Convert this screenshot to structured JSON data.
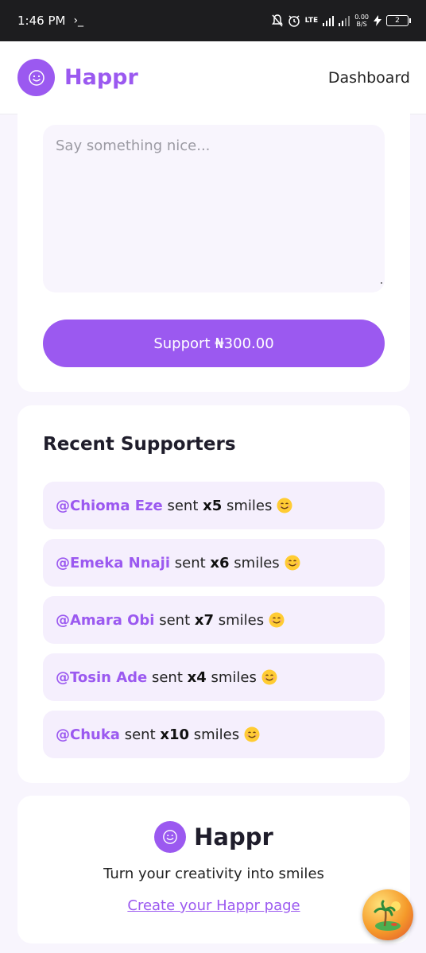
{
  "status_bar": {
    "time": "1:46 PM",
    "terminal_glyph": "›_",
    "network": "LTE",
    "speed_value": "0.00",
    "speed_unit": "B/S",
    "battery": "2"
  },
  "header": {
    "brand": "Happr",
    "nav_link": "Dashboard",
    "logo_icon": "smiley-icon"
  },
  "support_form": {
    "placeholder": "Say something nice...",
    "value": "",
    "button_label": "Support ₦300.00"
  },
  "supporters": {
    "title": "Recent Supporters",
    "sent_word": "sent",
    "smiles_word": "smiles",
    "items": [
      {
        "name": "@Chioma Eze",
        "count": "x5"
      },
      {
        "name": "@Emeka Nnaji",
        "count": "x6"
      },
      {
        "name": "@Amara Obi",
        "count": "x7"
      },
      {
        "name": "@Tosin Ade",
        "count": "x4"
      },
      {
        "name": "@Chuka",
        "count": "x10"
      }
    ]
  },
  "footer": {
    "brand": "Happr",
    "tagline": "Turn your creativity into smiles",
    "link": "Create your Happr page"
  },
  "colors": {
    "accent": "#9b59f0",
    "background": "#f8f5fd",
    "item_bg": "#f5effd"
  }
}
